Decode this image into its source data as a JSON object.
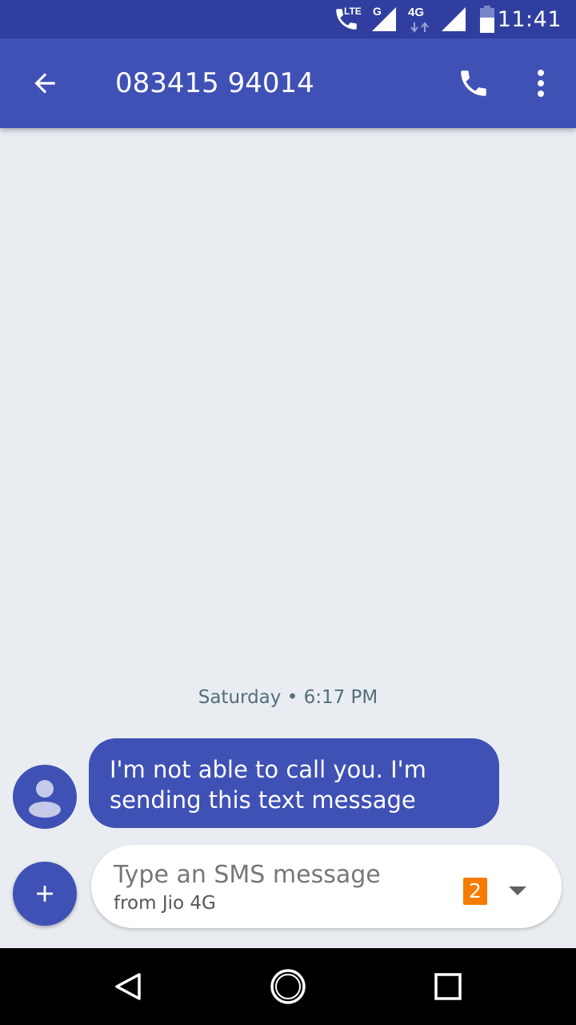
{
  "status_bar": {
    "time": "11:41",
    "volte_label": "LTE",
    "sim1_network": "G",
    "sim2_network": "4G",
    "icons": [
      "volte-call-icon",
      "signal-icon",
      "data-arrows-icon",
      "signal-icon",
      "battery-icon"
    ]
  },
  "app_bar": {
    "title": "083415 94014",
    "icons": [
      "back-arrow-icon",
      "phone-icon",
      "more-vert-icon"
    ]
  },
  "conversation": {
    "date_label": "Saturday • 6:17 PM",
    "messages": [
      {
        "text": "I'm not able to call you. I'm sending this text message",
        "direction": "incoming"
      }
    ]
  },
  "compose": {
    "placeholder": "Type an SMS message",
    "sim_label": "from Jio 4G",
    "sim_badge": "2",
    "icons": [
      "add-icon",
      "dropdown-arrow-icon"
    ]
  },
  "nav_bar": {
    "icons": [
      "back-triangle-icon",
      "home-circle-icon",
      "recents-square-icon"
    ]
  },
  "colors": {
    "status_bar": "#303f9f",
    "primary": "#3f51b5",
    "background": "#e9edf1",
    "sim_badge": "#f57c00"
  }
}
